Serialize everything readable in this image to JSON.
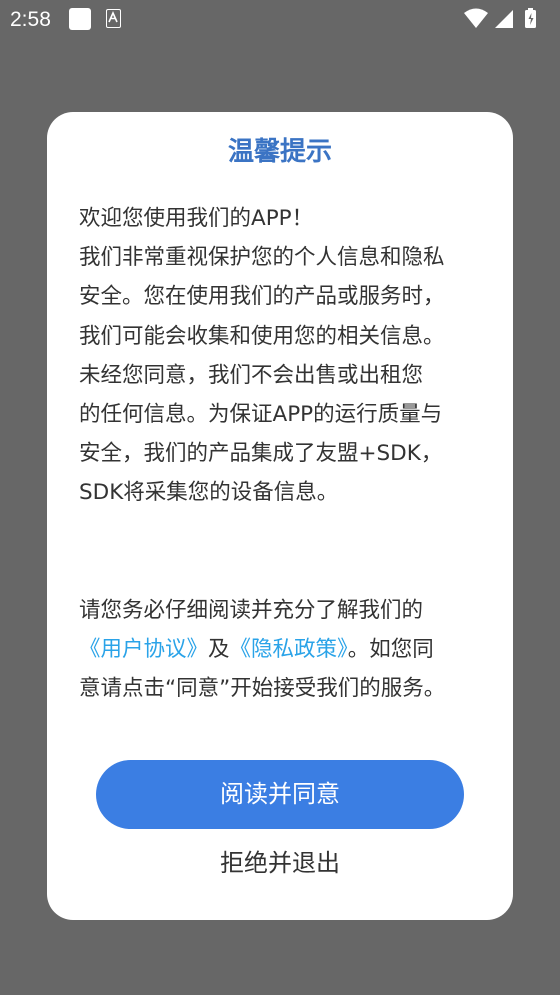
{
  "status_bar": {
    "time": "2:58"
  },
  "dialog": {
    "title": "温馨提示",
    "lines": [
      "欢迎您使用我们的APP！",
      "我们非常重视保护您的个人信息和隐私",
      "安全。您在使用我们的产品或服务时，",
      "我们可能会收集和使用您的相关信息。",
      "未经您同意，我们不会出售或出租您",
      "的任何信息。为保证APP的运行质量与",
      "安全，我们的产品集成了友盟+SDK，",
      "SDK将采集您的设备信息。"
    ],
    "para2_line1": "请您务必仔细阅读并充分了解我们的",
    "user_agreement_link": "《用户协议》",
    "and_text": "及",
    "privacy_policy_link": "《隐私政策》",
    "after_links_text": "。如您同",
    "para2_line3": "意请点击“同意”开始接受我们的服务。",
    "agree_button": "阅读并同意",
    "reject_button": "拒绝并退出"
  },
  "colors": {
    "overlay": "#676767",
    "title": "#3b74c4",
    "link": "#2aa3e8",
    "primary_button": "#3b7ee3"
  }
}
